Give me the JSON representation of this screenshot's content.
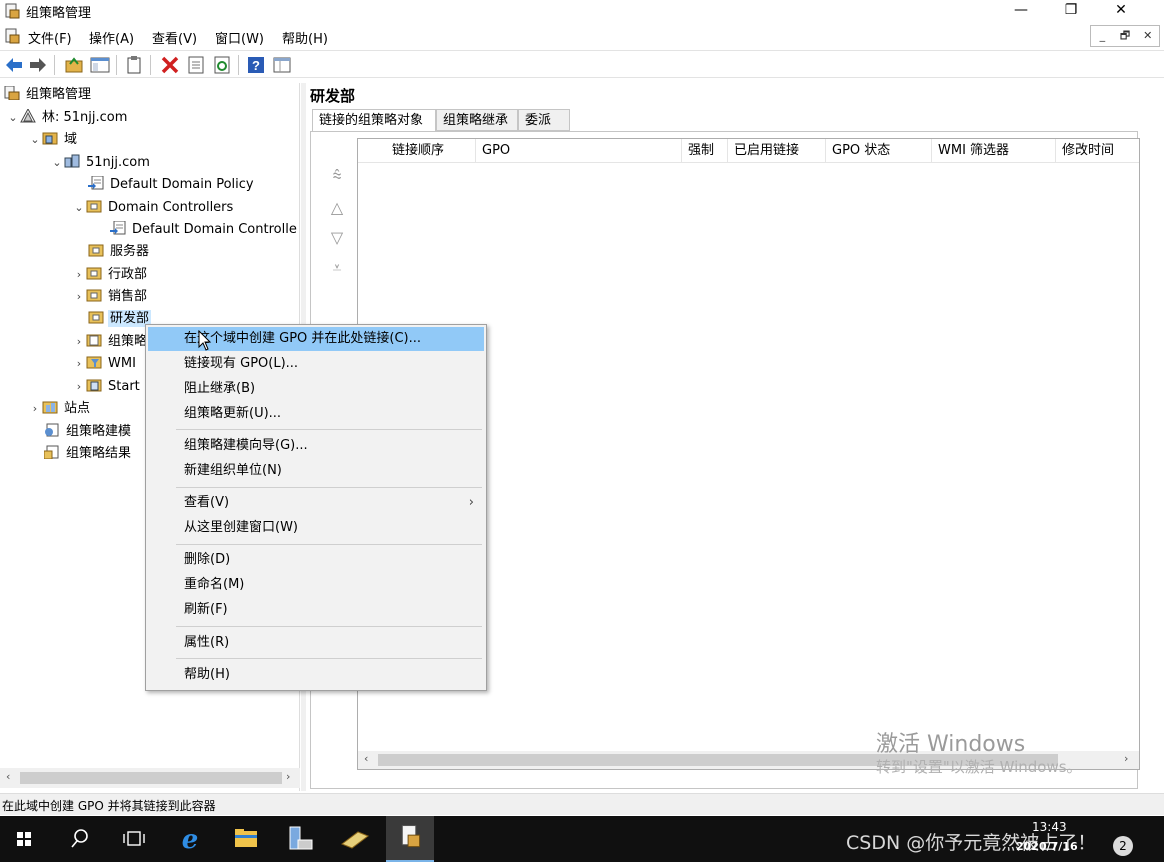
{
  "window": {
    "title": "组策略管理",
    "minimize": "—",
    "maximize": "❐",
    "close": "✕"
  },
  "menubar": {
    "items": [
      "文件(F)",
      "操作(A)",
      "查看(V)",
      "窗口(W)",
      "帮助(H)"
    ],
    "mdi": [
      "_",
      "🗗",
      "✕"
    ]
  },
  "tree": {
    "root": "组策略管理",
    "forest": "林: 51njj.com",
    "domains": "域",
    "domain": "51njj.com",
    "default_domain_policy": "Default Domain Policy",
    "domain_controllers": "Domain Controllers",
    "default_dc_policy": "Default Domain Controlle",
    "servers": "服务器",
    "admin_dept": "行政部",
    "sales_dept": "销售部",
    "rd_dept": "研发部",
    "gp_objects": "组策略",
    "wmi": "WMI",
    "starter": "Start",
    "sites": "站点",
    "modeling": "组策略建模",
    "results": "组策略结果"
  },
  "right": {
    "title": "研发部",
    "tabs": [
      "链接的组策略对象",
      "组策略继承",
      "委派"
    ],
    "columns": [
      "链接顺序",
      "GPO",
      "强制",
      "已启用链接",
      "GPO 状态",
      "WMI 筛选器",
      "修改时间"
    ],
    "arrows": [
      "⩯",
      "△",
      "▽",
      "⩡"
    ]
  },
  "context_menu": {
    "items": [
      {
        "label": "在这个域中创建 GPO 并在此处链接(C)...",
        "highlight": true
      },
      {
        "label": "链接现有 GPO(L)..."
      },
      {
        "label": "阻止继承(B)"
      },
      {
        "label": "组策略更新(U)..."
      },
      {
        "label": "组策略建模向导(G)..."
      },
      {
        "label": "新建组织单位(N)"
      },
      {
        "label": "查看(V)",
        "submenu": "›"
      },
      {
        "label": "从这里创建窗口(W)"
      },
      {
        "label": "删除(D)"
      },
      {
        "label": "重命名(M)"
      },
      {
        "label": "刷新(F)"
      },
      {
        "label": "属性(R)"
      },
      {
        "label": "帮助(H)"
      }
    ]
  },
  "watermark": {
    "line1": "激活 Windows",
    "line2": "转到\"设置\"以激活 Windows。"
  },
  "status": {
    "text": "在此域中创建 GPO 并将其链接到此容器"
  },
  "taskbar": {
    "csdn": "CSDN @你予元竟然被占了！",
    "time": "13:43",
    "date": "2020/7/16",
    "notifications": "2"
  },
  "colors": {
    "highlight": "#91c9f7",
    "selected": "#cce8ff",
    "taskbar": "#101010"
  }
}
